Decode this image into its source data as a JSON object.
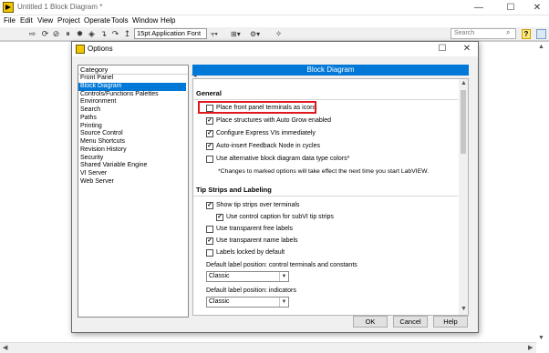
{
  "main": {
    "title": "Untitled 1 Block Diagram *",
    "menu": [
      "File",
      "Edit",
      "View",
      "Project",
      "Operate",
      "Tools",
      "Window",
      "Help"
    ],
    "font_dropdown": "15pt Application Font",
    "search_placeholder": "Search",
    "win_minimize": "—",
    "win_maximize": "☐",
    "win_close": "✕"
  },
  "dialog": {
    "title": "Options",
    "win_maximize": "☐",
    "win_close": "✕",
    "category_header": "Category",
    "categories": [
      "Front Panel",
      "Block Diagram",
      "Controls/Functions Palettes",
      "Environment",
      "Search",
      "Paths",
      "Printing",
      "Source Control",
      "Menu Shortcuts",
      "Revision History",
      "Security",
      "Shared Variable Engine",
      "VI Server",
      "Web Server"
    ],
    "selected_category": "Block Diagram",
    "panel_header": "Block Diagram",
    "general": {
      "title": "General",
      "options": [
        {
          "label": "Place front panel terminals as icons",
          "checked": false
        },
        {
          "label": "Place structures with Auto Grow enabled",
          "checked": true
        },
        {
          "label": "Configure Express VIs immediately",
          "checked": true
        },
        {
          "label": "Auto-insert Feedback Node in cycles",
          "checked": true
        },
        {
          "label": "Use alternative block diagram data type colors*",
          "checked": false
        }
      ],
      "note": "*Changes to marked options will take effect the next time you start LabVIEW."
    },
    "tip_strips": {
      "title": "Tip Strips and Labeling",
      "options": [
        {
          "label": "Show tip strips over terminals",
          "checked": true
        },
        {
          "label": "Use control caption for subVI tip strips",
          "checked": true
        },
        {
          "label": "Use transparent free labels",
          "checked": false
        },
        {
          "label": "Use transparent name labels",
          "checked": true
        },
        {
          "label": "Labels locked by default",
          "checked": false
        }
      ],
      "label_position_controls": "Default label position: control terminals and constants",
      "label_position_controls_value": "Classic",
      "label_position_indicators": "Default label position: indicators",
      "label_position_indicators_value": "Classic"
    },
    "buttons": {
      "ok": "OK",
      "cancel": "Cancel",
      "help": "Help"
    },
    "check_glyph": "✓"
  }
}
